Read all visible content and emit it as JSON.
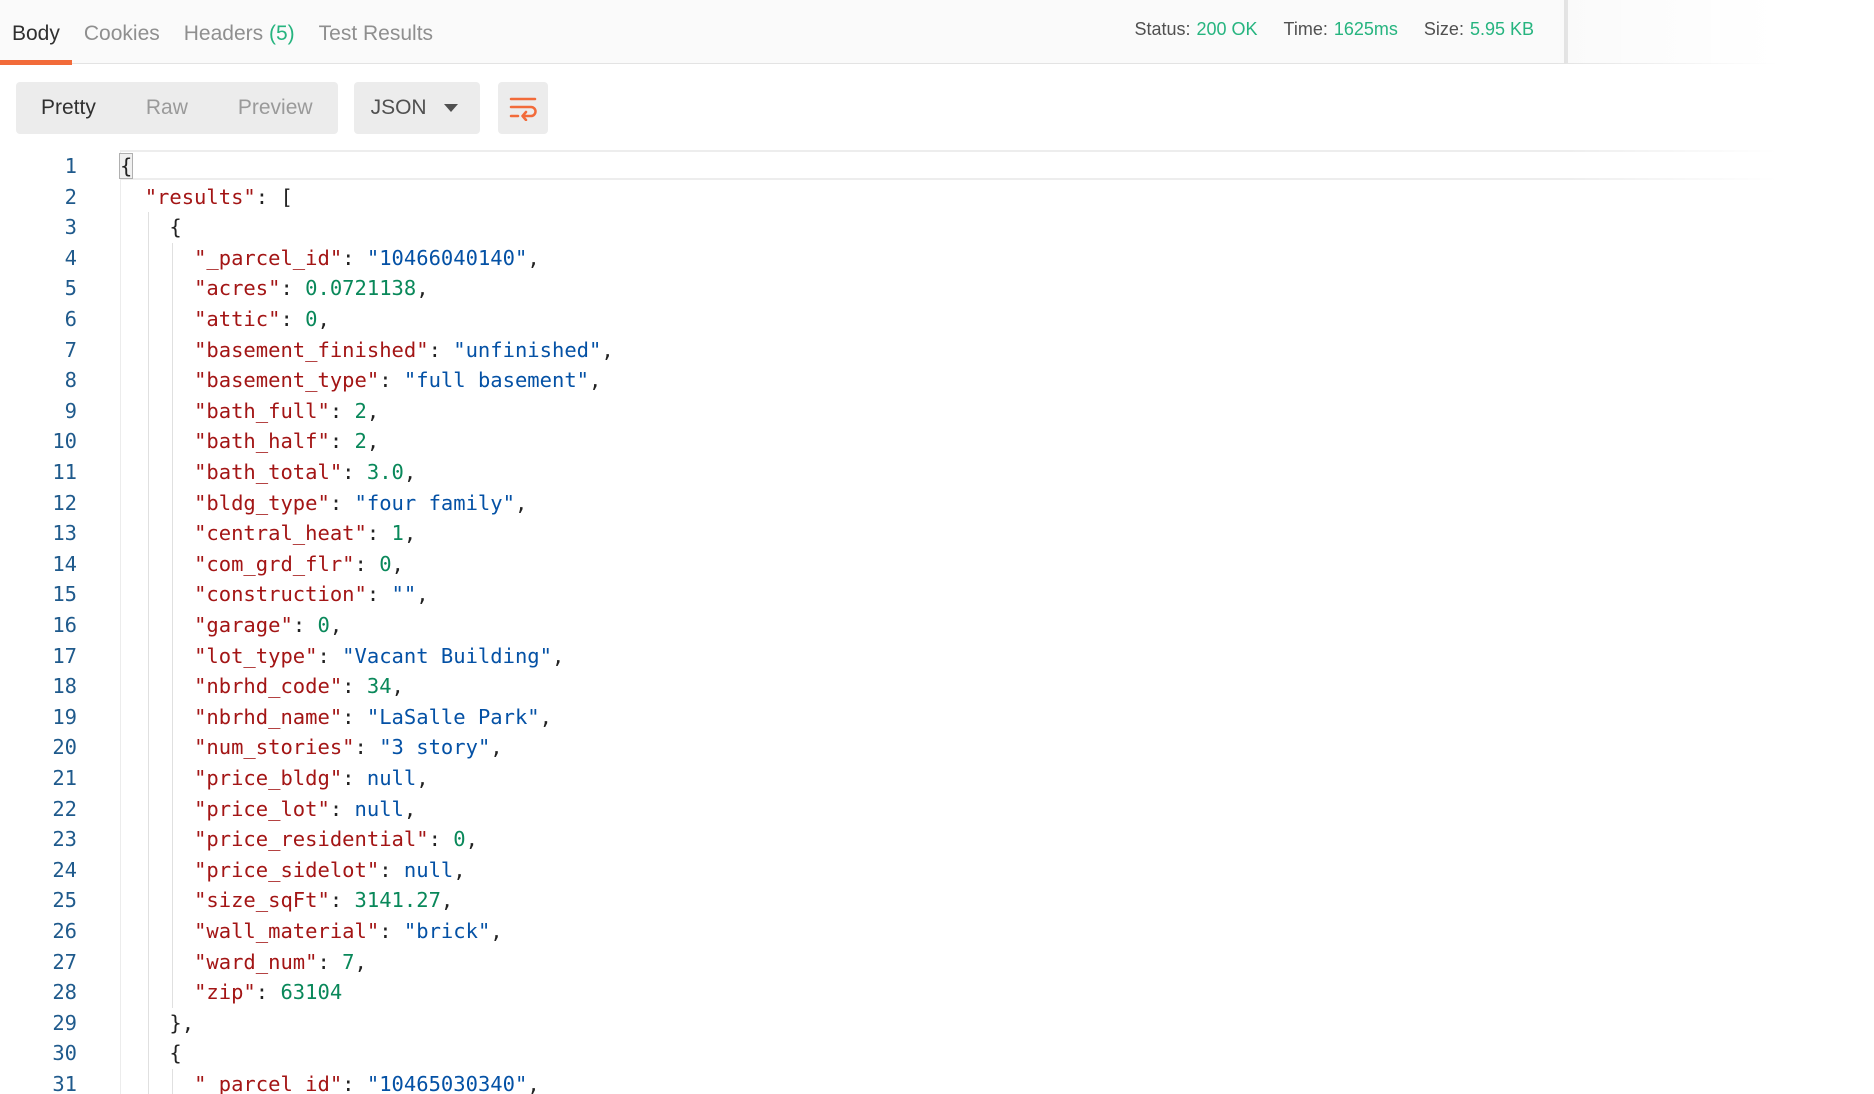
{
  "tabs": [
    {
      "label": "Body",
      "count": ""
    },
    {
      "label": "Cookies",
      "count": ""
    },
    {
      "label": "Headers",
      "count": "(5)"
    },
    {
      "label": "Test Results",
      "count": ""
    }
  ],
  "status": {
    "status_label": "Status:",
    "status_value": "200 OK",
    "time_label": "Time:",
    "time_value": "1625ms",
    "size_label": "Size:",
    "size_value": "5.95 KB"
  },
  "view_modes": [
    "Pretty",
    "Raw",
    "Preview"
  ],
  "active_view": "Pretty",
  "format": "JSON",
  "wrap_icon": "wrap-lines-icon",
  "colors": {
    "accent": "#f26b3a",
    "success": "#26b47f",
    "line_number": "#1f5a8c"
  },
  "code_lines": [
    {
      "n": "1",
      "indent": 0,
      "tokens": [
        {
          "t": "p",
          "v": "{"
        }
      ]
    },
    {
      "n": "2",
      "indent": 1,
      "tokens": [
        {
          "t": "k",
          "v": "\"results\""
        },
        {
          "t": "p",
          "v": ": ["
        }
      ]
    },
    {
      "n": "3",
      "indent": 2,
      "tokens": [
        {
          "t": "p",
          "v": "{"
        }
      ]
    },
    {
      "n": "4",
      "indent": 3,
      "tokens": [
        {
          "t": "k",
          "v": "\"_parcel_id\""
        },
        {
          "t": "p",
          "v": ": "
        },
        {
          "t": "s",
          "v": "\"10466040140\""
        },
        {
          "t": "p",
          "v": ","
        }
      ]
    },
    {
      "n": "5",
      "indent": 3,
      "tokens": [
        {
          "t": "k",
          "v": "\"acres\""
        },
        {
          "t": "p",
          "v": ": "
        },
        {
          "t": "n",
          "v": "0.0721138"
        },
        {
          "t": "p",
          "v": ","
        }
      ]
    },
    {
      "n": "6",
      "indent": 3,
      "tokens": [
        {
          "t": "k",
          "v": "\"attic\""
        },
        {
          "t": "p",
          "v": ": "
        },
        {
          "t": "n",
          "v": "0"
        },
        {
          "t": "p",
          "v": ","
        }
      ]
    },
    {
      "n": "7",
      "indent": 3,
      "tokens": [
        {
          "t": "k",
          "v": "\"basement_finished\""
        },
        {
          "t": "p",
          "v": ": "
        },
        {
          "t": "s",
          "v": "\"unfinished\""
        },
        {
          "t": "p",
          "v": ","
        }
      ]
    },
    {
      "n": "8",
      "indent": 3,
      "tokens": [
        {
          "t": "k",
          "v": "\"basement_type\""
        },
        {
          "t": "p",
          "v": ": "
        },
        {
          "t": "s",
          "v": "\"full basement\""
        },
        {
          "t": "p",
          "v": ","
        }
      ]
    },
    {
      "n": "9",
      "indent": 3,
      "tokens": [
        {
          "t": "k",
          "v": "\"bath_full\""
        },
        {
          "t": "p",
          "v": ": "
        },
        {
          "t": "n",
          "v": "2"
        },
        {
          "t": "p",
          "v": ","
        }
      ]
    },
    {
      "n": "10",
      "indent": 3,
      "tokens": [
        {
          "t": "k",
          "v": "\"bath_half\""
        },
        {
          "t": "p",
          "v": ": "
        },
        {
          "t": "n",
          "v": "2"
        },
        {
          "t": "p",
          "v": ","
        }
      ]
    },
    {
      "n": "11",
      "indent": 3,
      "tokens": [
        {
          "t": "k",
          "v": "\"bath_total\""
        },
        {
          "t": "p",
          "v": ": "
        },
        {
          "t": "n",
          "v": "3.0"
        },
        {
          "t": "p",
          "v": ","
        }
      ]
    },
    {
      "n": "12",
      "indent": 3,
      "tokens": [
        {
          "t": "k",
          "v": "\"bldg_type\""
        },
        {
          "t": "p",
          "v": ": "
        },
        {
          "t": "s",
          "v": "\"four family\""
        },
        {
          "t": "p",
          "v": ","
        }
      ]
    },
    {
      "n": "13",
      "indent": 3,
      "tokens": [
        {
          "t": "k",
          "v": "\"central_heat\""
        },
        {
          "t": "p",
          "v": ": "
        },
        {
          "t": "n",
          "v": "1"
        },
        {
          "t": "p",
          "v": ","
        }
      ]
    },
    {
      "n": "14",
      "indent": 3,
      "tokens": [
        {
          "t": "k",
          "v": "\"com_grd_flr\""
        },
        {
          "t": "p",
          "v": ": "
        },
        {
          "t": "n",
          "v": "0"
        },
        {
          "t": "p",
          "v": ","
        }
      ]
    },
    {
      "n": "15",
      "indent": 3,
      "tokens": [
        {
          "t": "k",
          "v": "\"construction\""
        },
        {
          "t": "p",
          "v": ": "
        },
        {
          "t": "s",
          "v": "\"\""
        },
        {
          "t": "p",
          "v": ","
        }
      ]
    },
    {
      "n": "16",
      "indent": 3,
      "tokens": [
        {
          "t": "k",
          "v": "\"garage\""
        },
        {
          "t": "p",
          "v": ": "
        },
        {
          "t": "n",
          "v": "0"
        },
        {
          "t": "p",
          "v": ","
        }
      ]
    },
    {
      "n": "17",
      "indent": 3,
      "tokens": [
        {
          "t": "k",
          "v": "\"lot_type\""
        },
        {
          "t": "p",
          "v": ": "
        },
        {
          "t": "s",
          "v": "\"Vacant Building\""
        },
        {
          "t": "p",
          "v": ","
        }
      ]
    },
    {
      "n": "18",
      "indent": 3,
      "tokens": [
        {
          "t": "k",
          "v": "\"nbrhd_code\""
        },
        {
          "t": "p",
          "v": ": "
        },
        {
          "t": "n",
          "v": "34"
        },
        {
          "t": "p",
          "v": ","
        }
      ]
    },
    {
      "n": "19",
      "indent": 3,
      "tokens": [
        {
          "t": "k",
          "v": "\"nbrhd_name\""
        },
        {
          "t": "p",
          "v": ": "
        },
        {
          "t": "s",
          "v": "\"LaSalle Park\""
        },
        {
          "t": "p",
          "v": ","
        }
      ]
    },
    {
      "n": "20",
      "indent": 3,
      "tokens": [
        {
          "t": "k",
          "v": "\"num_stories\""
        },
        {
          "t": "p",
          "v": ": "
        },
        {
          "t": "s",
          "v": "\"3 story\""
        },
        {
          "t": "p",
          "v": ","
        }
      ]
    },
    {
      "n": "21",
      "indent": 3,
      "tokens": [
        {
          "t": "k",
          "v": "\"price_bldg\""
        },
        {
          "t": "p",
          "v": ": "
        },
        {
          "t": "kw",
          "v": "null"
        },
        {
          "t": "p",
          "v": ","
        }
      ]
    },
    {
      "n": "22",
      "indent": 3,
      "tokens": [
        {
          "t": "k",
          "v": "\"price_lot\""
        },
        {
          "t": "p",
          "v": ": "
        },
        {
          "t": "kw",
          "v": "null"
        },
        {
          "t": "p",
          "v": ","
        }
      ]
    },
    {
      "n": "23",
      "indent": 3,
      "tokens": [
        {
          "t": "k",
          "v": "\"price_residential\""
        },
        {
          "t": "p",
          "v": ": "
        },
        {
          "t": "n",
          "v": "0"
        },
        {
          "t": "p",
          "v": ","
        }
      ]
    },
    {
      "n": "24",
      "indent": 3,
      "tokens": [
        {
          "t": "k",
          "v": "\"price_sidelot\""
        },
        {
          "t": "p",
          "v": ": "
        },
        {
          "t": "kw",
          "v": "null"
        },
        {
          "t": "p",
          "v": ","
        }
      ]
    },
    {
      "n": "25",
      "indent": 3,
      "tokens": [
        {
          "t": "k",
          "v": "\"size_sqFt\""
        },
        {
          "t": "p",
          "v": ": "
        },
        {
          "t": "n",
          "v": "3141.27"
        },
        {
          "t": "p",
          "v": ","
        }
      ]
    },
    {
      "n": "26",
      "indent": 3,
      "tokens": [
        {
          "t": "k",
          "v": "\"wall_material\""
        },
        {
          "t": "p",
          "v": ": "
        },
        {
          "t": "s",
          "v": "\"brick\""
        },
        {
          "t": "p",
          "v": ","
        }
      ]
    },
    {
      "n": "27",
      "indent": 3,
      "tokens": [
        {
          "t": "k",
          "v": "\"ward_num\""
        },
        {
          "t": "p",
          "v": ": "
        },
        {
          "t": "n",
          "v": "7"
        },
        {
          "t": "p",
          "v": ","
        }
      ]
    },
    {
      "n": "28",
      "indent": 3,
      "tokens": [
        {
          "t": "k",
          "v": "\"zip\""
        },
        {
          "t": "p",
          "v": ": "
        },
        {
          "t": "n",
          "v": "63104"
        }
      ]
    },
    {
      "n": "29",
      "indent": 2,
      "tokens": [
        {
          "t": "p",
          "v": "},"
        }
      ]
    },
    {
      "n": "30",
      "indent": 2,
      "tokens": [
        {
          "t": "p",
          "v": "{"
        }
      ]
    },
    {
      "n": "31",
      "indent": 3,
      "tokens": [
        {
          "t": "k",
          "v": "\"_parcel_id\""
        },
        {
          "t": "p",
          "v": ": "
        },
        {
          "t": "s",
          "v": "\"10465030340\""
        },
        {
          "t": "p",
          "v": ","
        }
      ]
    }
  ]
}
